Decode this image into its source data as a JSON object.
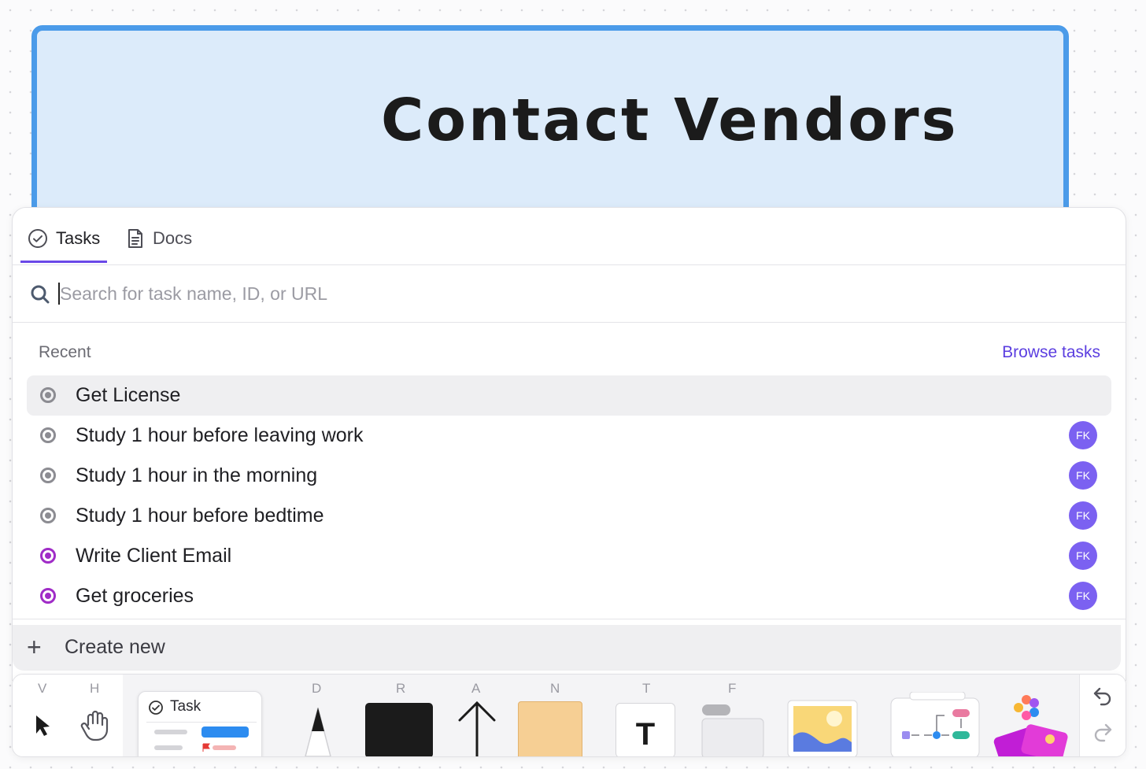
{
  "card": {
    "title": "Contact Vendors",
    "color": "#dcebfa",
    "border_color": "#4b9be9"
  },
  "tabs": [
    {
      "label": "Tasks",
      "icon": "check-circle-icon",
      "active": true
    },
    {
      "label": "Docs",
      "icon": "document-icon",
      "active": false
    }
  ],
  "search": {
    "placeholder": "Search for task name, ID, or URL",
    "value": ""
  },
  "recent": {
    "label": "Recent",
    "browse_label": "Browse tasks",
    "items": [
      {
        "label": "Get License",
        "status_color": "#8c8c92",
        "assignee": ""
      },
      {
        "label": "Study 1 hour before leaving work",
        "status_color": "#8c8c92",
        "assignee": "FK"
      },
      {
        "label": "Study 1 hour in the morning",
        "status_color": "#8c8c92",
        "assignee": "FK"
      },
      {
        "label": "Study 1 hour before bedtime",
        "status_color": "#8c8c92",
        "assignee": "FK"
      },
      {
        "label": "Write Client Email",
        "status_color": "#a02cc7",
        "assignee": "FK"
      },
      {
        "label": "Get groceries",
        "status_color": "#a02cc7",
        "assignee": "FK"
      }
    ]
  },
  "create": {
    "label": "Create new",
    "icon": "plus-icon"
  },
  "toolbar": {
    "keys": {
      "select": "V",
      "hand": "H",
      "pen": "D",
      "rect": "R",
      "arrow": "A",
      "note": "N",
      "text": "T",
      "frame": "F"
    },
    "task_label": "Task",
    "text_glyph": "T",
    "accent": "#6a48e8"
  }
}
